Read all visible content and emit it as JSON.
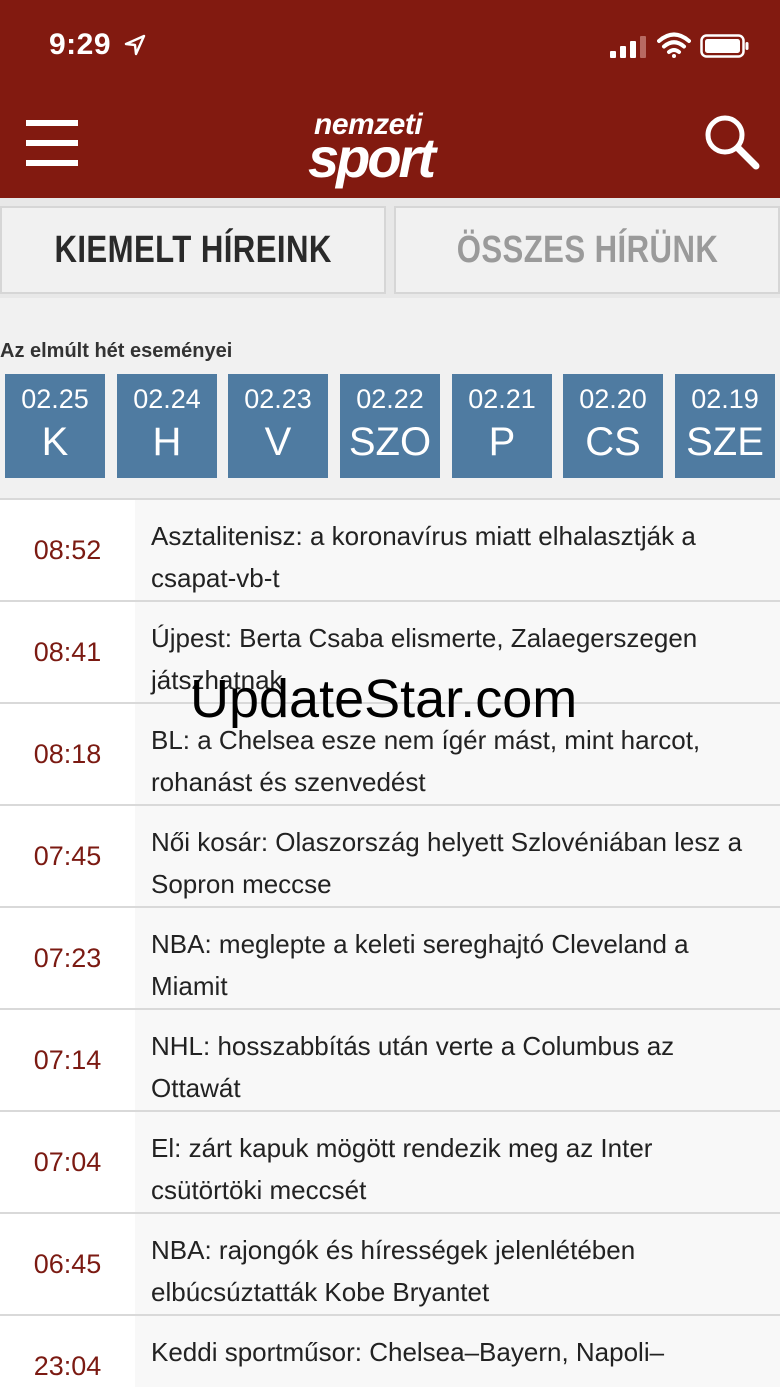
{
  "status_bar": {
    "time": "9:29"
  },
  "header": {
    "logo_top": "nemzeti",
    "logo_bottom": "sport"
  },
  "tabs": [
    {
      "label": "KIEMELT HÍREINK",
      "active": true
    },
    {
      "label": "ÖSSZES HÍRÜNK",
      "active": false
    }
  ],
  "week": {
    "title": "Az elmúlt hét eseményei",
    "days": [
      {
        "date": "02.25",
        "name": "K"
      },
      {
        "date": "02.24",
        "name": "H"
      },
      {
        "date": "02.23",
        "name": "V"
      },
      {
        "date": "02.22",
        "name": "SZO"
      },
      {
        "date": "02.21",
        "name": "P"
      },
      {
        "date": "02.20",
        "name": "CS"
      },
      {
        "date": "02.19",
        "name": "SZE"
      }
    ]
  },
  "news": [
    {
      "time": "08:52",
      "headline": "Asztalitenisz: a koronavírus miatt elhalasztják a csapat-vb-t"
    },
    {
      "time": "08:41",
      "headline": "Újpest: Berta Csaba elismerte, Zalaegerszegen játszhatnak"
    },
    {
      "time": "08:18",
      "headline": "BL: a Chelsea esze nem ígér mást, mint harcot, rohanást és szenvedést"
    },
    {
      "time": "07:45",
      "headline": "Női kosár: Olaszország helyett Szlovéniában lesz a Sopron meccse"
    },
    {
      "time": "07:23",
      "headline": "NBA: meglepte a keleti sereghajtó Cleveland a Miamit"
    },
    {
      "time": "07:14",
      "headline": "NHL: hosszabbítás után verte a Columbus az Ottawát"
    },
    {
      "time": "07:04",
      "headline": "El: zárt kapuk mögött rendezik meg az Inter csütörtöki meccsét"
    },
    {
      "time": "06:45",
      "headline": "NBA: rajongók és hírességek jelenlétében elbúcsúztatták Kobe Bryantet"
    },
    {
      "time": "23:04",
      "headline": "Keddi sportműsor: Chelsea–Bayern, Napoli–"
    }
  ],
  "watermark": "UpdateStar.com",
  "colors": {
    "brand": "#821a10",
    "day_tile": "#4f7ba1",
    "time_text": "#7b1a12"
  }
}
